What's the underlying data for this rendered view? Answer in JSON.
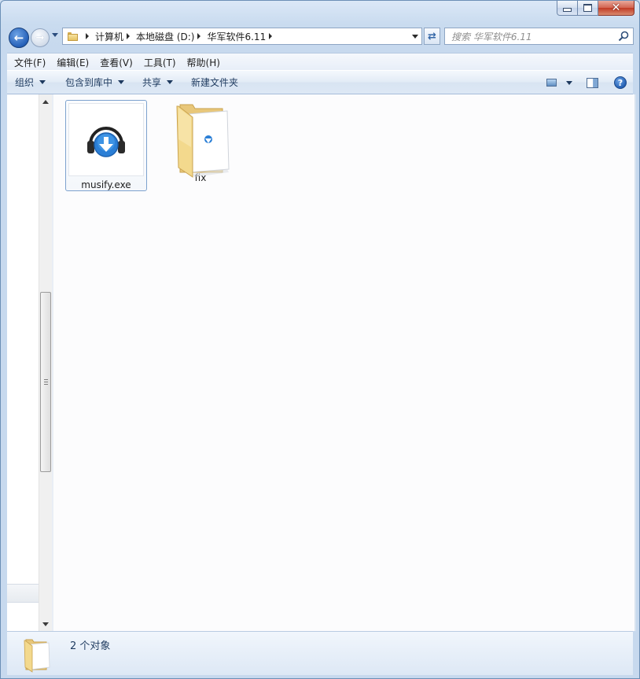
{
  "window": {
    "caption": {
      "minimize": "",
      "maximize": "",
      "close": "✕"
    }
  },
  "navigation": {
    "back_icon": "back-arrow-icon",
    "forward_icon": "forward-arrow-icon",
    "address": {
      "icon": "folder-icon",
      "crumbs": [
        "计算机",
        "本地磁盘 (D:)",
        "华军软件6.11"
      ]
    },
    "refresh_icon": "refresh-icon",
    "search": {
      "placeholder": "搜索 华军软件6.11"
    }
  },
  "menubar": {
    "items": [
      "文件(F)",
      "编辑(E)",
      "查看(V)",
      "工具(T)",
      "帮助(H)"
    ]
  },
  "commandbar": {
    "organize": "组织",
    "include_in_library": "包含到库中",
    "share": "共享",
    "new_folder": "新建文件夹",
    "help": "?"
  },
  "files": [
    {
      "name": "musify.exe",
      "type": "exe",
      "icon": "headphones-download-icon",
      "selected": true
    },
    {
      "name": "fix",
      "type": "folder",
      "icon": "folder-icon",
      "selected": false
    }
  ],
  "status": {
    "count_text": "2 个对象"
  },
  "colors": {
    "accent": "#2b7fd6",
    "folder": "#f1d68a",
    "selection_border": "#7da2ce"
  }
}
